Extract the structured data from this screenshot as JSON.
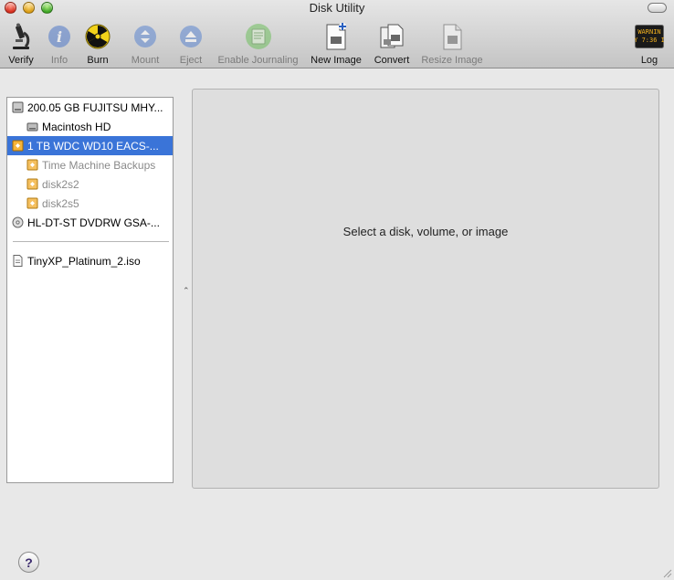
{
  "window": {
    "title": "Disk Utility"
  },
  "toolbar": {
    "items": [
      {
        "id": "verify",
        "label": "Verify",
        "icon": "microscope-icon",
        "enabled": true
      },
      {
        "id": "info",
        "label": "Info",
        "icon": "info-icon",
        "enabled": false
      },
      {
        "id": "burn",
        "label": "Burn",
        "icon": "burn-radiation-icon",
        "enabled": true
      },
      {
        "id": "mount",
        "label": "Mount",
        "icon": "mount-icon",
        "enabled": false
      },
      {
        "id": "eject",
        "label": "Eject",
        "icon": "eject-icon",
        "enabled": false
      },
      {
        "id": "enable-journaling",
        "label": "Enable Journaling",
        "icon": "journaling-icon",
        "enabled": false
      },
      {
        "id": "new-image",
        "label": "New Image",
        "icon": "new-image-icon",
        "enabled": true
      },
      {
        "id": "convert",
        "label": "Convert",
        "icon": "convert-icon",
        "enabled": true
      },
      {
        "id": "resize-image",
        "label": "Resize Image",
        "icon": "resize-image-icon",
        "enabled": false
      },
      {
        "id": "log",
        "label": "Log",
        "icon": "log-console-icon",
        "enabled": true
      }
    ],
    "log_icon_text": [
      "WARNIN",
      "Y 7:36 I"
    ]
  },
  "sidebar": {
    "items": [
      {
        "label": "200.05 GB FUJITSU MHY...",
        "icon": "internal-disk-icon",
        "indent": 0,
        "selected": false,
        "dim": false
      },
      {
        "label": "Macintosh HD",
        "icon": "volume-icon",
        "indent": 1,
        "selected": false,
        "dim": false
      },
      {
        "label": "1 TB WDC WD10 EACS-...",
        "icon": "external-disk-icon",
        "indent": 0,
        "selected": true,
        "dim": false
      },
      {
        "label": "Time Machine Backups",
        "icon": "external-volume-icon",
        "indent": 1,
        "selected": false,
        "dim": true
      },
      {
        "label": "disk2s2",
        "icon": "external-volume-icon",
        "indent": 1,
        "selected": false,
        "dim": true
      },
      {
        "label": "disk2s5",
        "icon": "external-volume-icon",
        "indent": 1,
        "selected": false,
        "dim": true
      },
      {
        "label": "HL-DT-ST DVDRW GSA-...",
        "icon": "optical-drive-icon",
        "indent": 0,
        "selected": false,
        "dim": false
      },
      {
        "label": "TinyXP_Platinum_2.iso",
        "icon": "disk-image-file-icon",
        "indent": 0,
        "selected": false,
        "dim": false
      }
    ]
  },
  "main": {
    "message": "Select a disk, volume, or image"
  },
  "help": {
    "label": "?"
  },
  "colors": {
    "selection": "#3a74d8",
    "panel": "#dedede",
    "window": "#e8e8e8"
  }
}
